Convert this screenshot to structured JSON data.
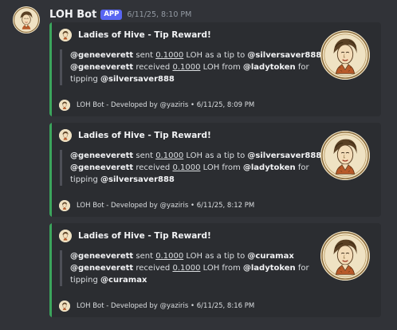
{
  "message": {
    "username": "LOH Bot",
    "badge": "APP",
    "timestamp": "6/11/25, 8:10 PM",
    "avatar_icon": "lady-portrait-icon"
  },
  "embeds": [
    {
      "title": "Ladies of Hive - Tip Reward!",
      "sender": "@geneeverett",
      "sent_text": " sent ",
      "amount": "0.1000",
      "tip_text": " LOH as a tip to ",
      "recipient": "@silversaver888",
      "receiver": "@geneeverett",
      "received_text": " received ",
      "amount2": "0.1000",
      "from_text": " LOH from ",
      "from_user": "@ladytoken",
      "for_text": " for",
      "tipping_text": "tipping ",
      "tipped_user": "@silversaver888",
      "footer": "LOH Bot - Developed by @yaziris • 6/11/25, 8:09 PM",
      "bar_color": "#3ba55c"
    },
    {
      "title": "Ladies of Hive - Tip Reward!",
      "sender": "@geneeverett",
      "sent_text": " sent ",
      "amount": "0.1000",
      "tip_text": " LOH as a tip to ",
      "recipient": "@silversaver888",
      "receiver": "@geneeverett",
      "received_text": " received ",
      "amount2": "0.1000",
      "from_text": " LOH from ",
      "from_user": "@ladytoken",
      "for_text": " for",
      "tipping_text": "tipping ",
      "tipped_user": "@silversaver888",
      "footer": "LOH Bot - Developed by @yaziris • 6/11/25, 8:12 PM",
      "bar_color": "#3ba55c"
    },
    {
      "title": "Ladies of Hive - Tip Reward!",
      "sender": "@geneeverett",
      "sent_text": " sent ",
      "amount": "0.1000",
      "tip_text": " LOH as a tip to ",
      "recipient": "@curamax",
      "receiver": "@geneeverett",
      "received_text": " received ",
      "amount2": "0.1000",
      "from_text": " LOH from ",
      "from_user": "@ladytoken",
      "for_text": " for",
      "tipping_text": "tipping ",
      "tipped_user": "@curamax",
      "footer": "LOH Bot - Developed by @yaziris • 6/11/25, 8:16 PM",
      "bar_color": "#3ba55c"
    }
  ],
  "colors": {
    "background": "#313338",
    "embed_bg": "#2b2d31",
    "accent": "#3ba55c",
    "badge": "#5865f2"
  }
}
